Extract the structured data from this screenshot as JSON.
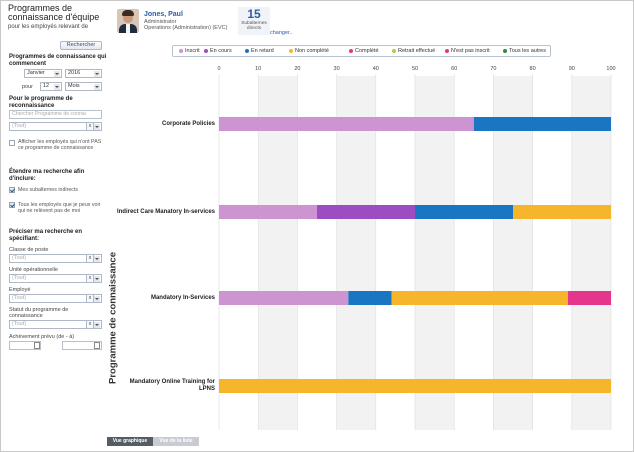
{
  "header": {
    "title": "Programmes de connaissance d'équipe",
    "subtitle": "pour les employés relevant de",
    "employee_name": "Jones, Paul",
    "employee_role": "Administrator",
    "employee_department": "Operations (Administration) (EVC)",
    "subordinates_count": "15",
    "subordinates_label_1": "Subalternes",
    "subordinates_label_2": "directs",
    "change_link": "changer.."
  },
  "sidebar": {
    "search_button": "Rechercher",
    "start_title": "Programmes de connaissance qui commencent",
    "month_value": "Janvier",
    "year_value": "2016",
    "for_label": "pour",
    "duration_value": "12",
    "unit_value": "Mois",
    "program_title": "Pour le programme de reconnaissance",
    "program_search_placeholder": "Chercher Programme de connai",
    "program_all": "(Tout)",
    "show_not_relevant_label": "Afficher les employés qui n'ont PAS ce programme de connaissance",
    "extend_title": "Étendre ma recherche afin d'inclure:",
    "indirect_label": "Mes subalternes indirects",
    "all_employees_label": "Tous les employés que je peux voir qui ne relèvent pas de moi",
    "refine_title": "Préciser ma recherche en spécifiant:",
    "position_class_label": "Classe de poste",
    "position_class_value": "(Tout)",
    "op_unit_label": "Unité opérationnelle",
    "op_unit_value": "(Tout)",
    "employee_label": "Employé",
    "employee_value": "(Tout)",
    "status_label": "Statut du programme de connaissance",
    "status_value": "(Tout)",
    "achievement_label": "Achèvement prévu (de - à)",
    "clear_x": "x"
  },
  "legend": [
    {
      "label": "Inscrit",
      "color": "#cd94d2"
    },
    {
      "label": "En cours",
      "color": "#9b4dc1"
    },
    {
      "label": "En retard",
      "color": "#1a76c2"
    },
    {
      "label": "Non complété",
      "color": "#f6b62c"
    },
    {
      "label": "Complété",
      "color": "#e6368b"
    },
    {
      "label": "Retrait effectué",
      "color": "#b5cc3c"
    },
    {
      "label": "N'est pas inscrit",
      "color": "#e23b6a"
    },
    {
      "label": "Tous les autres",
      "color": "#2e8b3a"
    }
  ],
  "chart_data": {
    "type": "bar",
    "orientation": "horizontal",
    "stacked": true,
    "ylabel": "Programme de connaissance",
    "xlim": [
      0,
      100
    ],
    "xticks": [
      0,
      10,
      20,
      30,
      40,
      50,
      60,
      70,
      80,
      90,
      100
    ],
    "categories": [
      "Corporate Policies",
      "Indirect Care Manatory In-services",
      "Mandatory In-Services",
      "Mandatory Online Training for LPNS"
    ],
    "series": [
      {
        "name": "Inscrit",
        "color": "#cd94d2",
        "values": [
          65,
          25,
          33,
          0
        ]
      },
      {
        "name": "En cours",
        "color": "#9b4dc1",
        "values": [
          0,
          25,
          0,
          0
        ]
      },
      {
        "name": "En retard",
        "color": "#1a76c2",
        "values": [
          35,
          25,
          11,
          0
        ]
      },
      {
        "name": "Non complété",
        "color": "#f6b62c",
        "values": [
          0,
          25,
          45,
          100
        ]
      },
      {
        "name": "Complété",
        "color": "#e6368b",
        "values": [
          0,
          0,
          11,
          0
        ]
      }
    ]
  },
  "tabs": {
    "chart_view": "Vue graphique",
    "list_view": "Vue de la liste"
  }
}
